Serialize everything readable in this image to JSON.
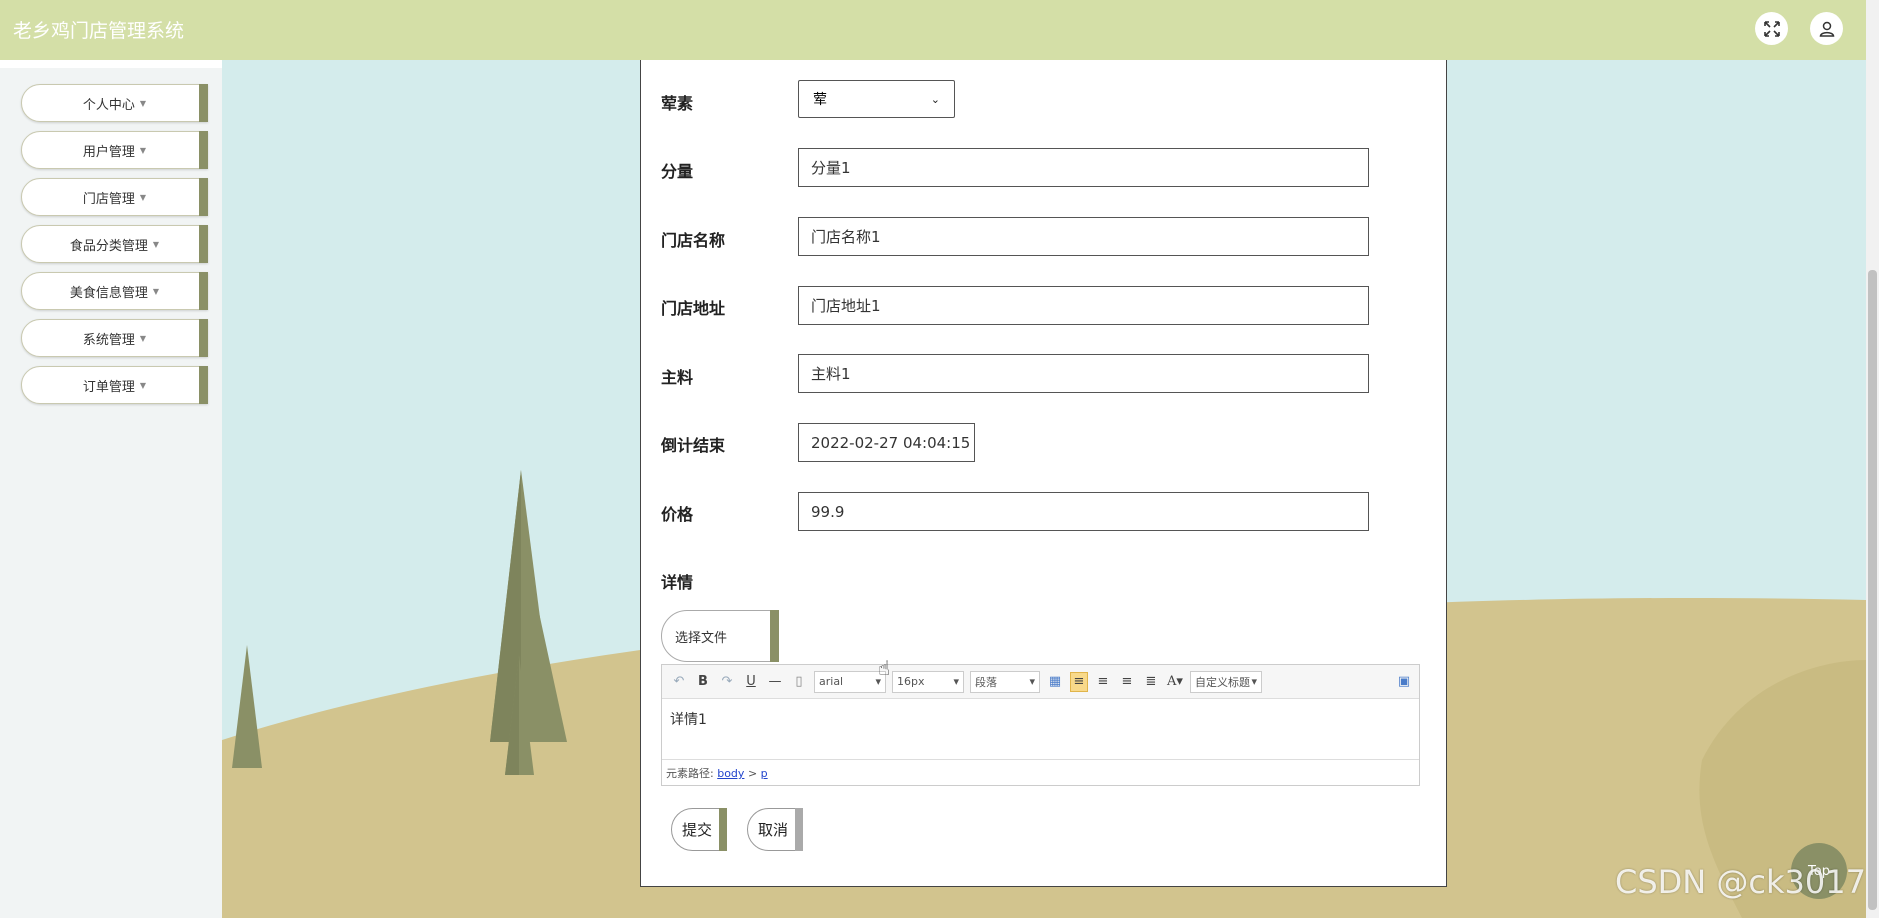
{
  "app": {
    "title": "老乡鸡门店管理系统"
  },
  "header": {
    "fullscreen_icon": "expand-icon",
    "user_icon": "user-icon"
  },
  "sidebar": {
    "items": [
      {
        "label": "个人中心"
      },
      {
        "label": "用户管理"
      },
      {
        "label": "门店管理"
      },
      {
        "label": "食品分类管理"
      },
      {
        "label": "美食信息管理"
      },
      {
        "label": "系统管理"
      },
      {
        "label": "订单管理"
      }
    ]
  },
  "form": {
    "meat_veg": {
      "label": "荤素",
      "value": "荤"
    },
    "portion": {
      "label": "分量",
      "value": "分量1"
    },
    "store_name": {
      "label": "门店名称",
      "value": "门店名称1"
    },
    "store_address": {
      "label": "门店地址",
      "value": "门店地址1"
    },
    "main_ingredient": {
      "label": "主料",
      "value": "主料1"
    },
    "countdown_end": {
      "label": "倒计结束",
      "value": "2022-02-27 04:04:15"
    },
    "price": {
      "label": "价格",
      "value": "99.9"
    },
    "details": {
      "label": "详情",
      "file_button": "选择文件",
      "toolbar": {
        "font": "arial",
        "size": "16px",
        "paragraph": "段落",
        "heading": "自定义标题"
      },
      "content": "详情1",
      "path_label": "元素路径:",
      "path_body": "body",
      "path_sep": ">",
      "path_p": "p"
    },
    "submit_label": "提交",
    "cancel_label": "取消"
  },
  "top_button": "Top",
  "watermark": "CSDN @ck3017",
  "colors": {
    "header": "#d4dfa7",
    "accent": "#8a9066"
  }
}
